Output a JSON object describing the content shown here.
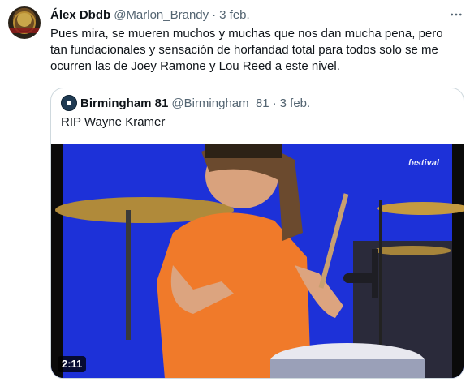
{
  "tweet": {
    "display_name": "Álex Dbdb",
    "handle": "@Marlon_Brandy",
    "separator": "·",
    "time": "3 feb.",
    "text_lines": [
      "Pues mira, se mueren muchos y muchas que nos dan mucha pena, pero",
      "tan fundacionales y sensación de horfandad total para todos solo se me",
      "ocurren las de Joey Ramone y Lou Reed a este nivel."
    ]
  },
  "quote": {
    "display_name": "Birmingham 81",
    "handle": "@Birmingham_81",
    "separator": "·",
    "time": "3 feb.",
    "text": "RIP Wayne Kramer",
    "video": {
      "duration": "2:11",
      "watermark": "festival"
    }
  },
  "colors": {
    "text_primary": "#0f1419",
    "text_secondary": "#536471",
    "border": "#cfd9de",
    "video_background": "#1c2fd6",
    "shirt": "#f07a2a"
  },
  "icons": {
    "more": "more-horizontal-icon"
  }
}
